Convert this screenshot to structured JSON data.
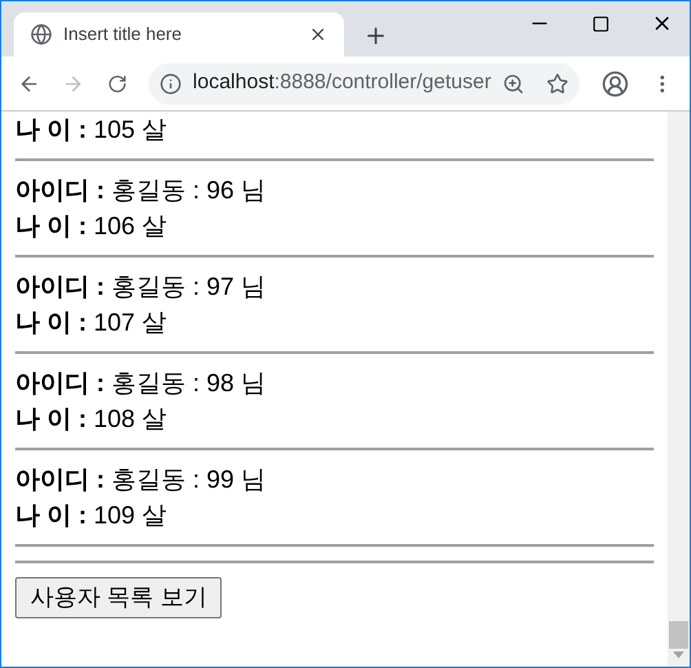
{
  "tab": {
    "title": "Insert title here"
  },
  "address_bar": {
    "host": "localhost",
    "rest": ":8888/controller/getuser"
  },
  "records": [
    {
      "age": "**나 이 :** 105 살"
    },
    {
      "id": "**아이디 :** 홍길동 : 96 님",
      "age": "**나 이 :** 106 살"
    },
    {
      "id": "**아이디 :** 홍길동 : 97 님",
      "age": "**나 이 :** 107 살"
    },
    {
      "id": "**아이디 :** 홍길동 : 98 님",
      "age": "**나 이 :** 108 살"
    },
    {
      "id": "**아이디 :** 홍길동 : 99 님",
      "age": "**나 이 :** 109 살"
    }
  ],
  "button": "사용자 목록 보기"
}
